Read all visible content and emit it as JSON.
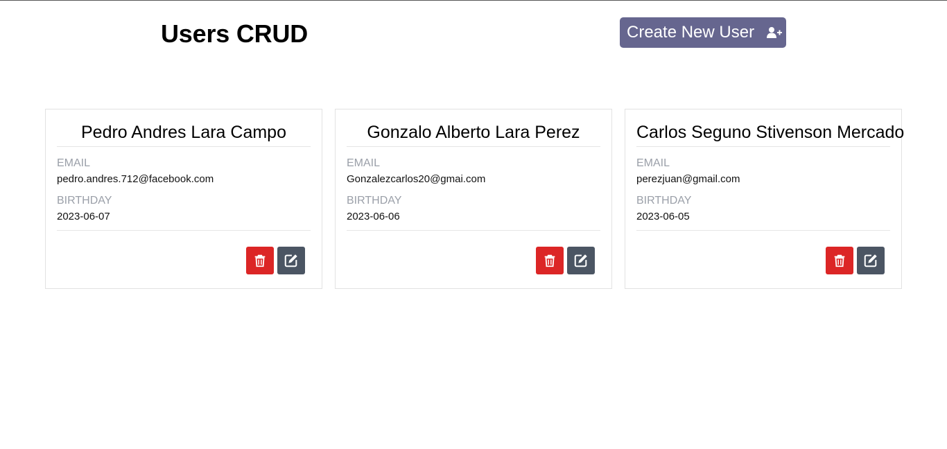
{
  "header": {
    "title": "Users CRUD",
    "create_button_label": "Create New User",
    "create_button_icon": "user-plus-icon",
    "create_button_color": "#66668f"
  },
  "users": [
    {
      "name": "Pedro Andres Lara Campo",
      "email_label": "EMAIL",
      "email": "pedro.andres.712@facebook.com",
      "birthday_label": "BIRTHDAY",
      "birthday": "2023-06-07"
    },
    {
      "name": "Gonzalo Alberto Lara Perez",
      "email_label": "EMAIL",
      "email": "Gonzalezcarlos20@gmai.com",
      "birthday_label": "BIRTHDAY",
      "birthday": "2023-06-06"
    },
    {
      "name": "Carlos Seguno Stivenson Mercado",
      "email_label": "EMAIL",
      "email": "perezjuan@gmail.com",
      "birthday_label": "BIRTHDAY",
      "birthday": "2023-06-05"
    }
  ],
  "actions": {
    "delete_icon": "trash-icon",
    "delete_color": "#dc2626",
    "edit_icon": "edit-icon",
    "edit_color": "#4b5563"
  }
}
